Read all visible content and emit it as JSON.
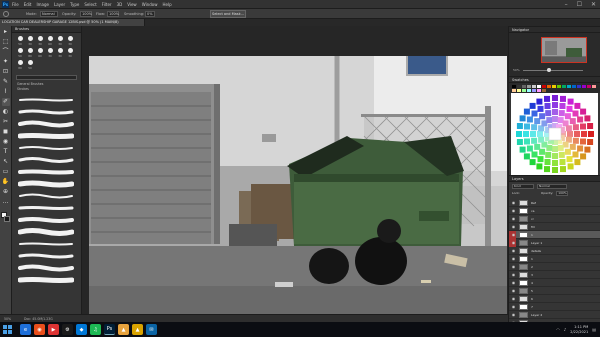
{
  "app": {
    "logo": "Ps",
    "menus": [
      "File",
      "Edit",
      "Image",
      "Layer",
      "Type",
      "Select",
      "Filter",
      "3D",
      "View",
      "Window",
      "Help"
    ],
    "window_controls": [
      "–",
      "☐",
      "✕"
    ]
  },
  "options_bar": {
    "opacity_label": "Opacity:",
    "opacity_value": "100%",
    "flow_label": "Flow:",
    "flow_value": "100%",
    "mode_label": "Mode:",
    "mode_value": "Normal",
    "smoothing_label": "Smoothing:",
    "smoothing_value": "0%",
    "select_mask_button": "Select and Mask..."
  },
  "document": {
    "tab_title": "LOCATION CAR DEALERSHIP GARAGE 12BIS.psd @ 50% (1 MAIN/8)"
  },
  "tools": [
    "▸",
    "⬚",
    "⌒",
    "✦",
    "⊡",
    "✎",
    "⌇",
    "✐",
    "◐",
    "✂",
    "◼",
    "◉",
    "T",
    "↖",
    "▭",
    "✋",
    "⊕",
    "…"
  ],
  "brushes_panel": {
    "title": "Brushes",
    "tip_sizes": [
      "50",
      "30",
      "30",
      "60",
      "30",
      "30",
      "50",
      "80",
      "60",
      "30",
      "30",
      "30",
      "80",
      "50"
    ],
    "group_label": "General Brushes",
    "group2_label": "Strokes"
  },
  "status_bar": {
    "zoom": "50%",
    "doc_info": "Doc: 45.0M/1.23G"
  },
  "right_panels": {
    "navigator_title": "Navigator",
    "navigator_zoom": "50%",
    "swatches_title": "Swatches",
    "color_title": "Color",
    "layers_title": "Layers",
    "kind_label": "Kind",
    "blend_mode": "Normal",
    "opacity_label": "Opacity:",
    "opacity_value": "100%",
    "lock_label": "Lock:",
    "fill_label": "Fill:",
    "fill_value": "100%",
    "layers": [
      {
        "name": "Ref",
        "selected": false,
        "red": false
      },
      {
        "name": "ca",
        "selected": false,
        "red": false
      },
      {
        "name": "cr",
        "selected": false,
        "red": false
      },
      {
        "name": "fill",
        "selected": false,
        "red": false
      },
      {
        "name": "1",
        "selected": true,
        "red": true
      },
      {
        "name": "Layer 1",
        "selected": false,
        "red": true
      },
      {
        "name": "details",
        "selected": false,
        "red": false
      },
      {
        "name": "1",
        "selected": false,
        "red": false
      },
      {
        "name": "2",
        "selected": false,
        "red": false
      },
      {
        "name": "3",
        "selected": false,
        "red": false
      },
      {
        "name": "4",
        "selected": false,
        "red": false
      },
      {
        "name": "5",
        "selected": false,
        "red": false
      },
      {
        "name": "6",
        "selected": false,
        "red": false
      },
      {
        "name": "7",
        "selected": false,
        "red": false
      },
      {
        "name": "Layer 2",
        "selected": false,
        "red": false
      },
      {
        "name": "BG",
        "selected": false,
        "red": false
      }
    ],
    "footer_icons": [
      "fx",
      "◑",
      "▣",
      "＋",
      "🗑"
    ]
  },
  "taskbar": {
    "apps": [
      "e",
      "◉",
      "▶",
      "⚙",
      "◆",
      "♫",
      "Ps",
      "▲",
      "▲",
      "✉"
    ],
    "time": "1:11 PM",
    "date": "2/22/2021"
  },
  "colors": {
    "accent_red": "#a33333",
    "dumpster_green": "#3e5c3a"
  }
}
